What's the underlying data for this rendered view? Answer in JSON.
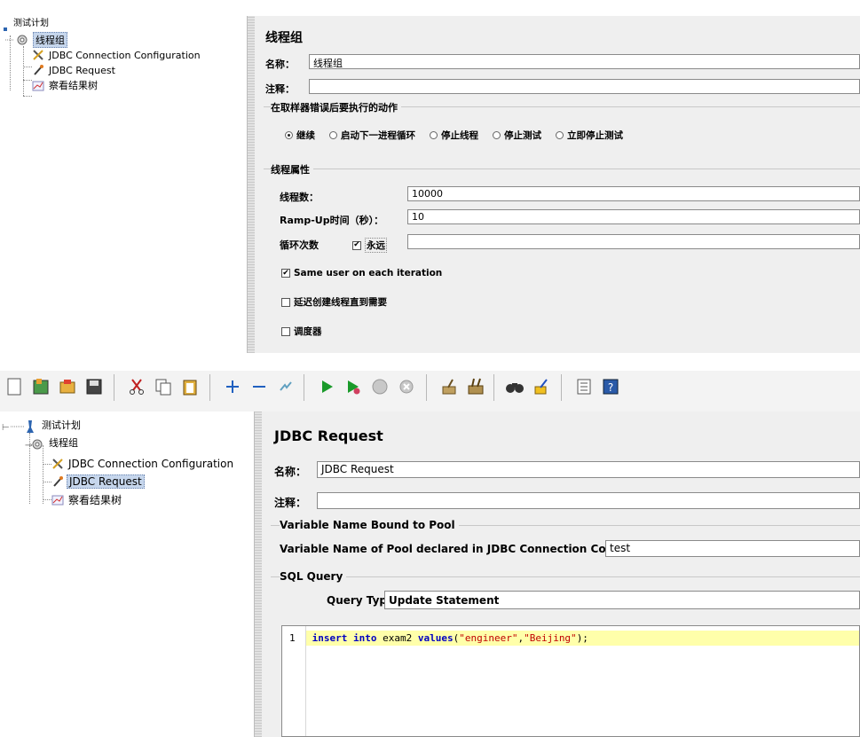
{
  "top": {
    "tree": {
      "root": "测试计划",
      "group": "线程组",
      "items": [
        "JDBC Connection Configuration",
        "JDBC Request",
        "察看结果树"
      ]
    },
    "panel_title": "线程组",
    "name_label": "名称：",
    "name_value": "线程组",
    "comment_label": "注释：",
    "error_group_title": "在取样器错误后要执行的动作",
    "error_options": [
      "继续",
      "启动下一进程循环",
      "停止线程",
      "停止测试",
      "立即停止测试"
    ],
    "thread_props_title": "线程属性",
    "threads_label": "线程数：",
    "threads_value": "10000",
    "rampup_label": "Ramp-Up时间（秒）：",
    "rampup_value": "10",
    "loop_label": "循环次数",
    "forever_label": "永远",
    "same_user_label": "Same user on each iteration",
    "delay_label": "延迟创建线程直到需要",
    "scheduler_label": "调度器"
  },
  "bottom": {
    "tree": {
      "root": "测试计划",
      "group": "线程组",
      "items": [
        "JDBC Connection Configuration",
        "JDBC Request",
        "察看结果树"
      ]
    },
    "panel_title": "JDBC Request",
    "name_label": "名称：",
    "name_value": "JDBC Request",
    "comment_label": "注释：",
    "pool_group_title": "Variable Name Bound to Pool",
    "pool_label": "Variable Name of Pool declared in JDBC Connection Configuration:",
    "pool_value": "test",
    "sql_group_title": "SQL Query",
    "query_type_label": "Query Type:",
    "query_type_value": "Update Statement",
    "code_line_number": "1",
    "code": {
      "kw1": "insert into",
      "table": " exam2 ",
      "kw2": "values",
      "open": "(",
      "s1": "\"engineer\"",
      "comma": ",",
      "s2": "\"Beijing\"",
      "close": ");"
    }
  },
  "colors": {
    "selection": "#c6d6ec",
    "panel": "#efefef",
    "code_highlight": "#ffffaa",
    "keyword": "#0000c0",
    "string": "#c00000"
  }
}
